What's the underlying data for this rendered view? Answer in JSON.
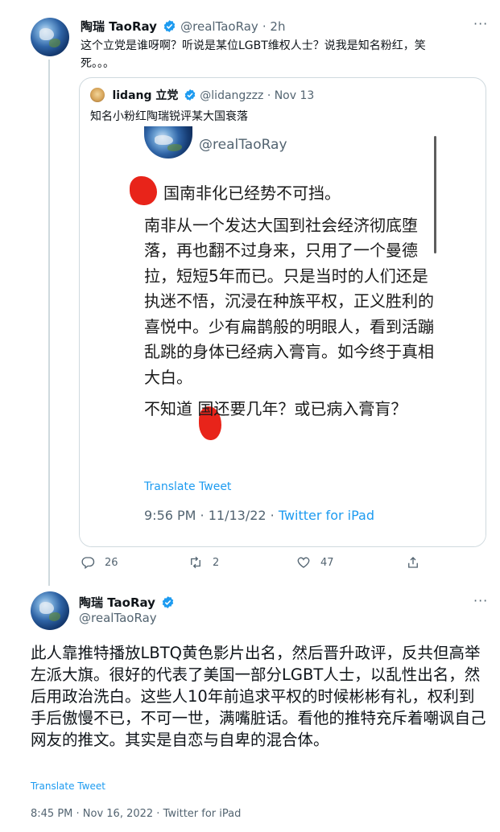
{
  "tweet1": {
    "display_name": "陶瑞 TaoRay",
    "handle": "@realTaoRay",
    "time": "· 2h",
    "text_line1": "这个立党是谁呀啊？听说是某位LGBT维权人士？说我是知名粉红，笑",
    "text_line2": "死。。。"
  },
  "quote": {
    "display_name": "lidang 立党",
    "handle": "@lidangzzz",
    "time": "· Nov 13",
    "text": "知名小粉红陶瑞锐评某大国衰落",
    "screenshot": {
      "handle": "@realTaoRay",
      "p1": "国南非化已经势不可挡。",
      "p2": "南非从一个发达大国到社会经济彻底堕落，再也翻不过身来，只用了一个曼德拉，短短5年而已。只是当时的人们还是执迷不悟，沉浸在种族平权，正义胜利的喜悦中。少有扁鹊般的明眼人，看到活蹦乱跳的身体已经病入膏肓。如今终于真相大白。",
      "p3": "不知道 国还要几年？或已病入膏肓？",
      "translate": "Translate Tweet",
      "meta": "9:56 PM · 11/13/22 · ",
      "source": "Twitter for iPad"
    }
  },
  "actions": {
    "reply_count": "26",
    "retweet_count": "2",
    "like_count": "47"
  },
  "tweet2": {
    "display_name": "陶瑞 TaoRay",
    "handle": "@realTaoRay",
    "text": "此人靠推特播放LBTQ黄色影片出名，然后晋升政评，反共但高举左派大旗。很好的代表了美国一部分LGBT人士，以乱性出名，然后用政治洗白。这些人10年前追求平权的时候彬彬有礼，权利到手后傲慢不已，不可一世，满嘴脏话。看他的推特充斥着嘲讽自己网友的推文。其实是自恋与自卑的混合体。",
    "translate": "Translate Tweet",
    "meta": "8:45 PM · Nov 16, 2022 · Twitter for iPad"
  },
  "colors": {
    "link": "#1d9bf0",
    "muted": "#536471",
    "verified": "#1d9bf0",
    "redaction": "#e8241a"
  }
}
